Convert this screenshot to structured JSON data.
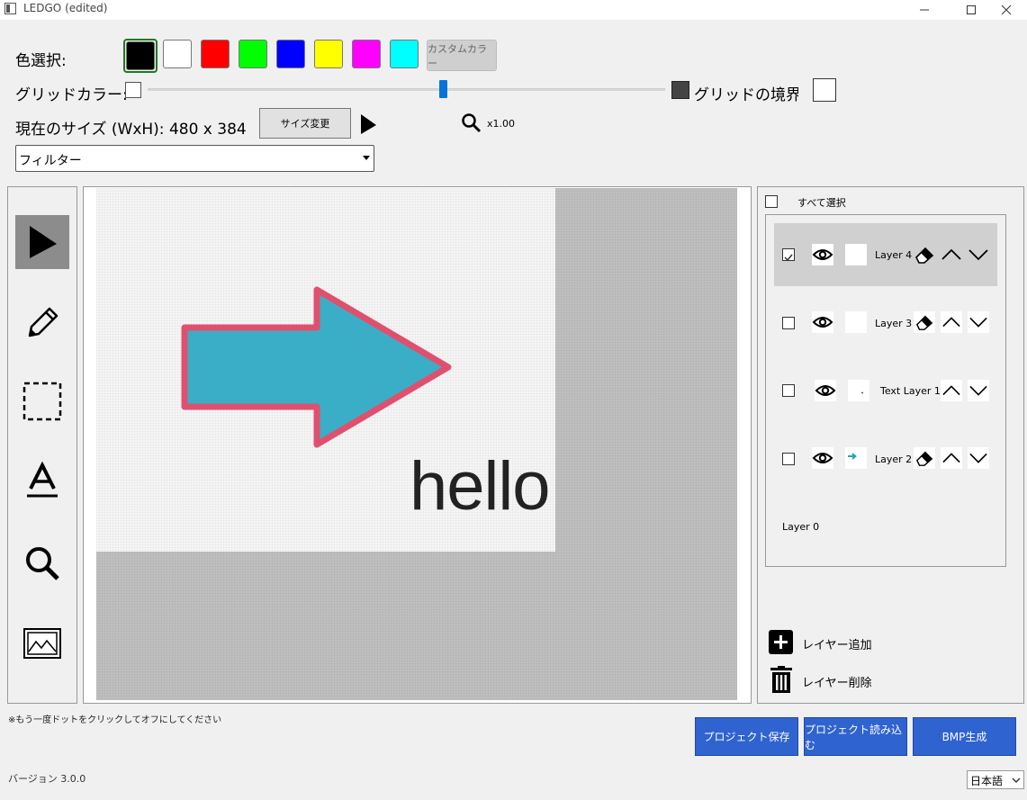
{
  "window": {
    "title": "LEDGO (edited)"
  },
  "colors": {
    "label": "色選択:",
    "swatches": [
      "#000000",
      "#ffffff",
      "#ff0000",
      "#00ff00",
      "#0000ff",
      "#ffff00",
      "#ff00ff",
      "#00ffff"
    ],
    "selected_index": 0,
    "custom_button": "カスタムカラー"
  },
  "grid": {
    "label": "グリッドカラー:",
    "slider_value_percent": 57,
    "border_label": "グリッドの境界線"
  },
  "size": {
    "label": "現在のサイズ (WxH): 480 x 384",
    "resize_button": "サイズ変更",
    "zoom_label": "x1.00"
  },
  "filter": {
    "selected": "フィルター"
  },
  "canvas": {
    "text": "hello",
    "arrow_fill": "#3aaec6",
    "arrow_stroke": "#e0506e"
  },
  "layers": {
    "select_all_label": "すべて選択",
    "items": [
      {
        "name": "Layer 4",
        "checked": true
      },
      {
        "name": "Layer 3",
        "checked": false
      },
      {
        "name": "Text Layer 1",
        "checked": false
      },
      {
        "name": "Layer 2",
        "checked": false
      }
    ],
    "base_layer": "Layer 0",
    "add_label": "レイヤー追加",
    "delete_label": "レイヤー削除"
  },
  "footer": {
    "hint": "※もう一度ドットをクリックしてオフにしてください",
    "save_button": "プロジェクト保存",
    "load_button": "プロジェクト読み込む",
    "bmp_button": "BMP生成",
    "version": "バージョン 3.0.0",
    "language": "日本語"
  },
  "accent": {
    "button_blue": "#2f63d0",
    "slider_blue": "#0a72d6"
  }
}
